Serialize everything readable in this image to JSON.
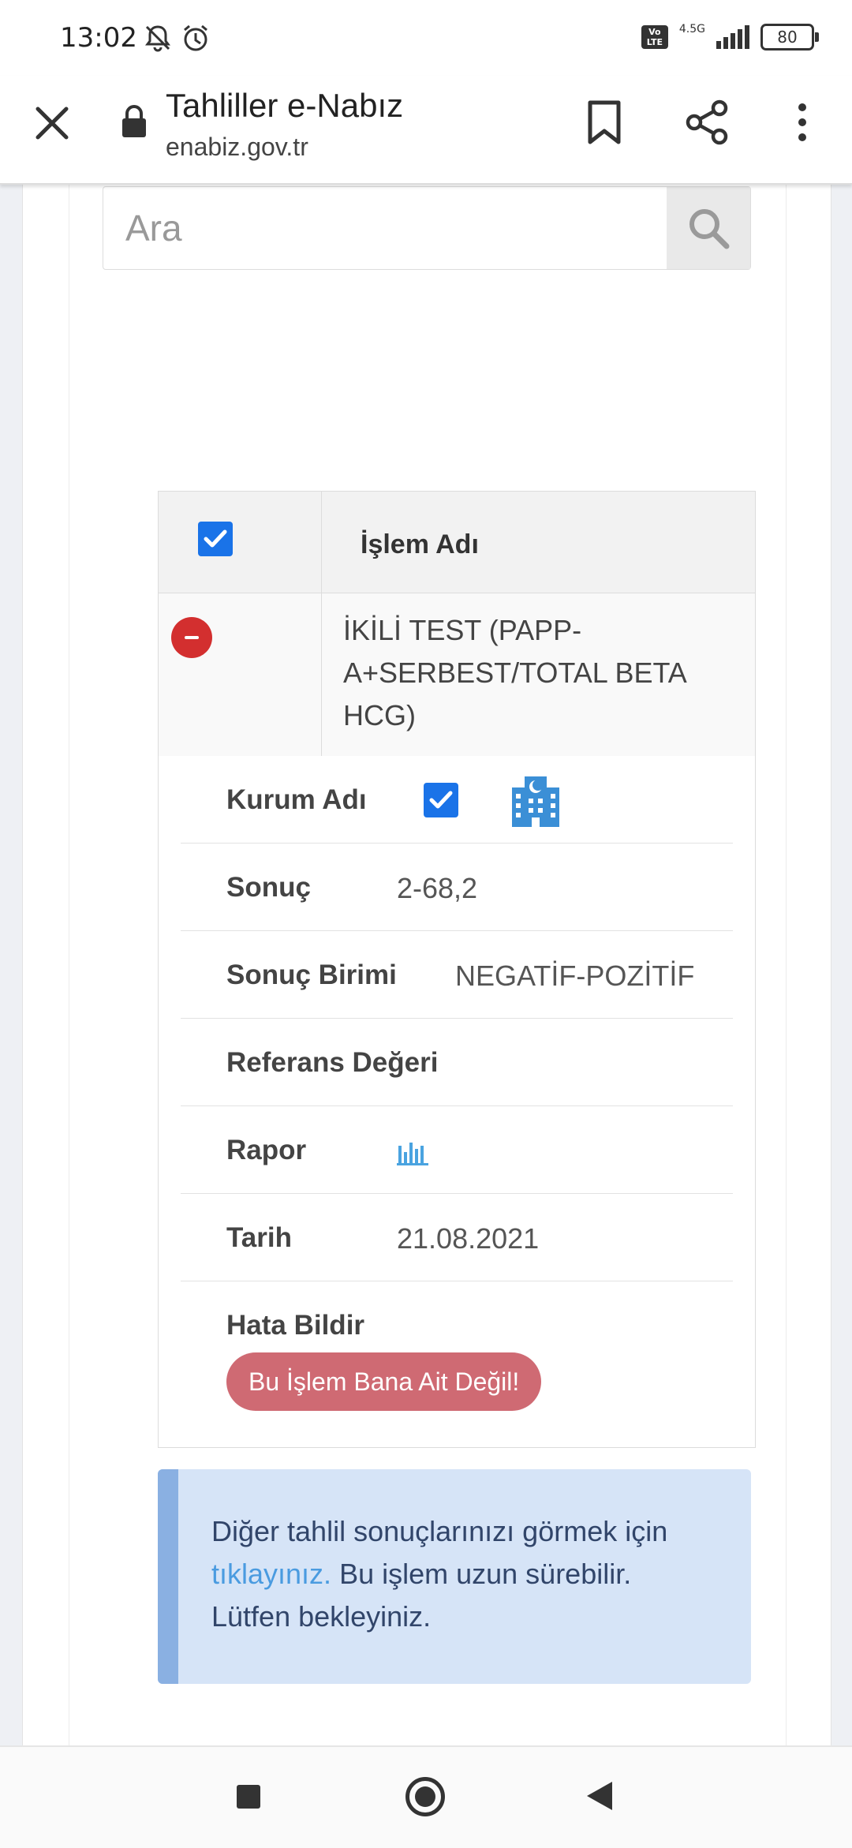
{
  "status_bar": {
    "time": "13:02",
    "icons": [
      "mute-bell-icon",
      "alarm-icon"
    ],
    "volte": "Vo LTE",
    "network": "4.5G",
    "battery": "80"
  },
  "browser": {
    "title": "Tahliller e-Nabız",
    "url": "enabiz.gov.tr"
  },
  "search": {
    "placeholder": "Ara"
  },
  "table": {
    "header_label": "İşlem Adı",
    "row_name": "İKİLİ TEST (PAPP-A+SERBEST/TOTAL BETA HCG)"
  },
  "details": {
    "kurum_label": "Kurum Adı",
    "sonuc_label": "Sonuç",
    "sonuc_value": "2-68,2",
    "birim_label": "Sonuç Birimi",
    "birim_value": "NEGATİF-POZİTİF",
    "referans_label": "Referans Değeri",
    "rapor_label": "Rapor",
    "tarih_label": "Tarih",
    "tarih_value": "21.08.2021",
    "hata_label": "Hata Bildir",
    "hata_button": "Bu İşlem Bana Ait Değil!"
  },
  "info": {
    "text_before": "Diğer tahlil sonuçlarınızı görmek için ",
    "link": "tıklayınız.",
    "text_after": " Bu işlem uzun sürebilir. Lütfen bekleyiniz."
  },
  "colors": {
    "accent": "#1a73e8",
    "danger": "#d32f2f",
    "error_button": "#cf6a73",
    "info_bg": "#d6e4f7",
    "info_bar": "#8ab0e2",
    "link": "#4a9be0"
  }
}
